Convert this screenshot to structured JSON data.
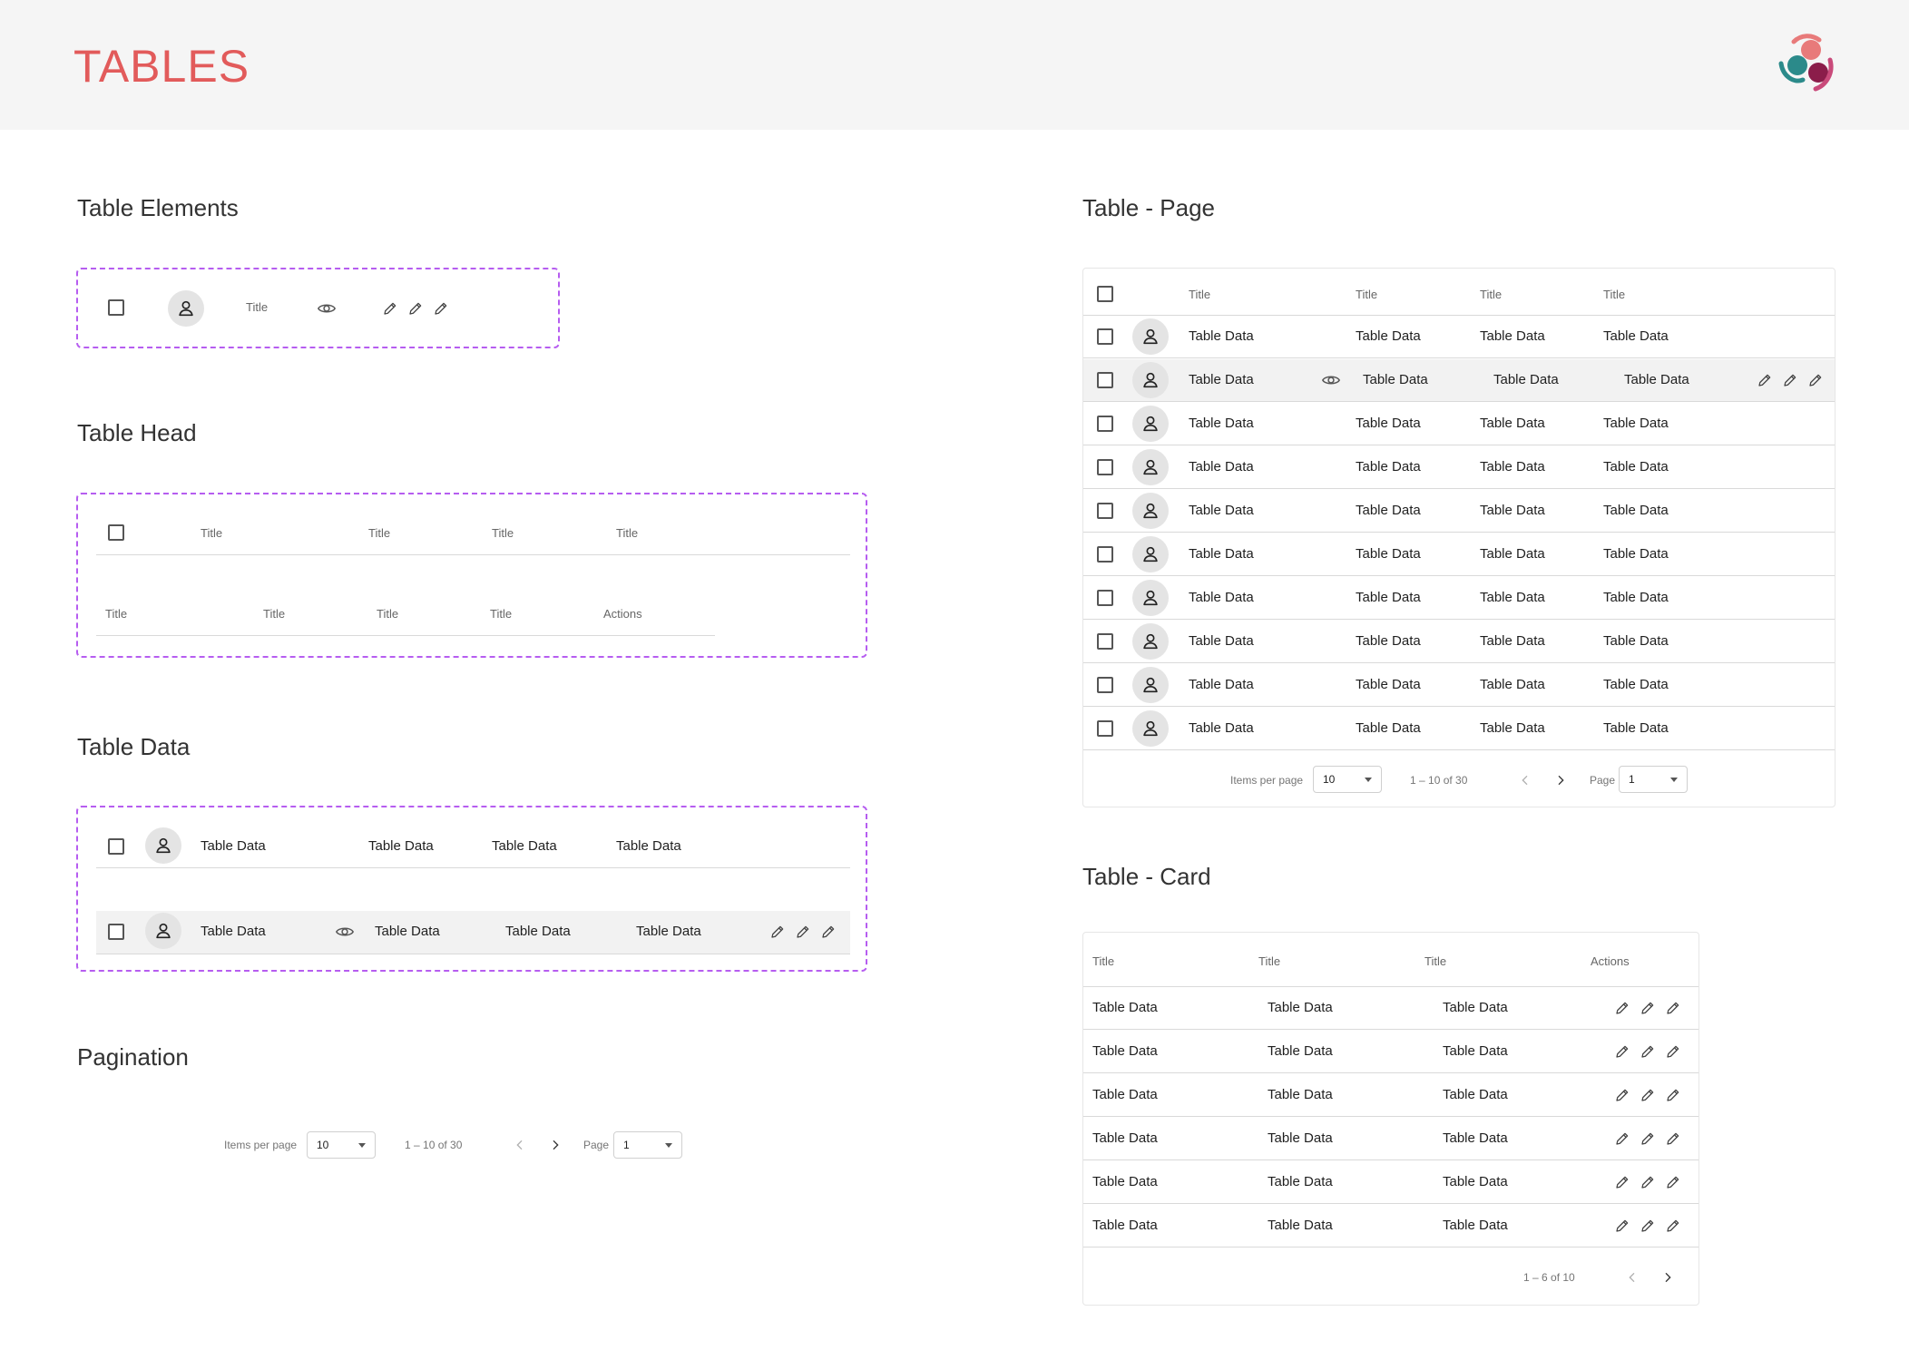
{
  "header": {
    "title": "TABLES"
  },
  "colors": {
    "accent": "#e25b5b",
    "dashed_border": "#b65df0",
    "logo": [
      "#e87a7a",
      "#2b8a8a",
      "#8b1d4a",
      "#c94a7a"
    ]
  },
  "sections": {
    "elements": "Table Elements",
    "head": "Table Head",
    "data": "Table Data",
    "pagination": "Pagination",
    "page": "Table - Page",
    "card": "Table - Card"
  },
  "elements": {
    "title": "Title"
  },
  "head": {
    "row1": [
      "Title",
      "Title",
      "Title",
      "Title"
    ],
    "row2": [
      "Title",
      "Title",
      "Title",
      "Title",
      "Actions"
    ]
  },
  "cell": "Table Data",
  "pagination": {
    "items_label": "Items per page",
    "items_value": "10",
    "range": "1 – 10 of 30",
    "page_label": "Page",
    "page_value": "1"
  },
  "page_table": {
    "headers": [
      "Title",
      "Title",
      "Title",
      "Title"
    ]
  },
  "card_table": {
    "headers": [
      "Title",
      "Title",
      "Title",
      "Actions"
    ],
    "range": "1 – 6 of 10"
  },
  "icons": {
    "checkbox": "checkbox-icon",
    "avatar": "person-icon",
    "view": "eye-icon",
    "edit": "pencil-icon",
    "prev": "chevron-left-icon",
    "next": "chevron-right-icon",
    "dropdown": "caret-down-icon"
  }
}
